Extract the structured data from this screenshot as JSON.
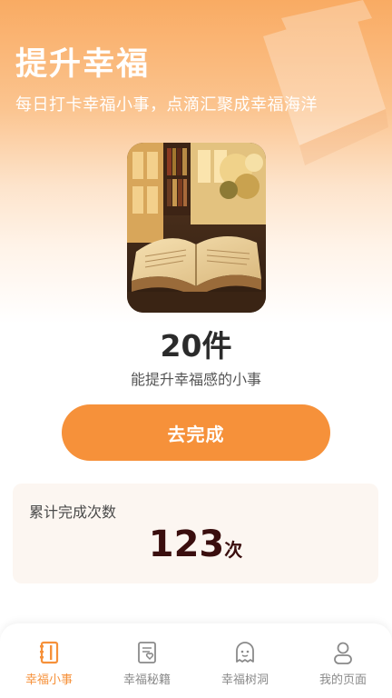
{
  "hero": {
    "title": "提升幸福",
    "subtitle": "每日打卡幸福小事，点滴汇聚成幸福海洋"
  },
  "summary": {
    "count": "20件",
    "label": "能提升幸福感的小事",
    "cta_label": "去完成"
  },
  "stats": {
    "label": "累计完成次数",
    "value": "123",
    "unit": "次"
  },
  "tabbar": {
    "items": [
      {
        "label": "幸福小事",
        "icon": "book-icon",
        "active": true
      },
      {
        "label": "幸福秘籍",
        "icon": "notebook-heart-icon",
        "active": false
      },
      {
        "label": "幸福树洞",
        "icon": "ghost-icon",
        "active": false
      },
      {
        "label": "我的页面",
        "icon": "person-icon",
        "active": false
      }
    ]
  },
  "colors": {
    "accent": "#f6913a",
    "inactive_tab": "#8a8a8a",
    "stats_text": "#3a0e0e",
    "card_bg": "#fcf6f1"
  }
}
